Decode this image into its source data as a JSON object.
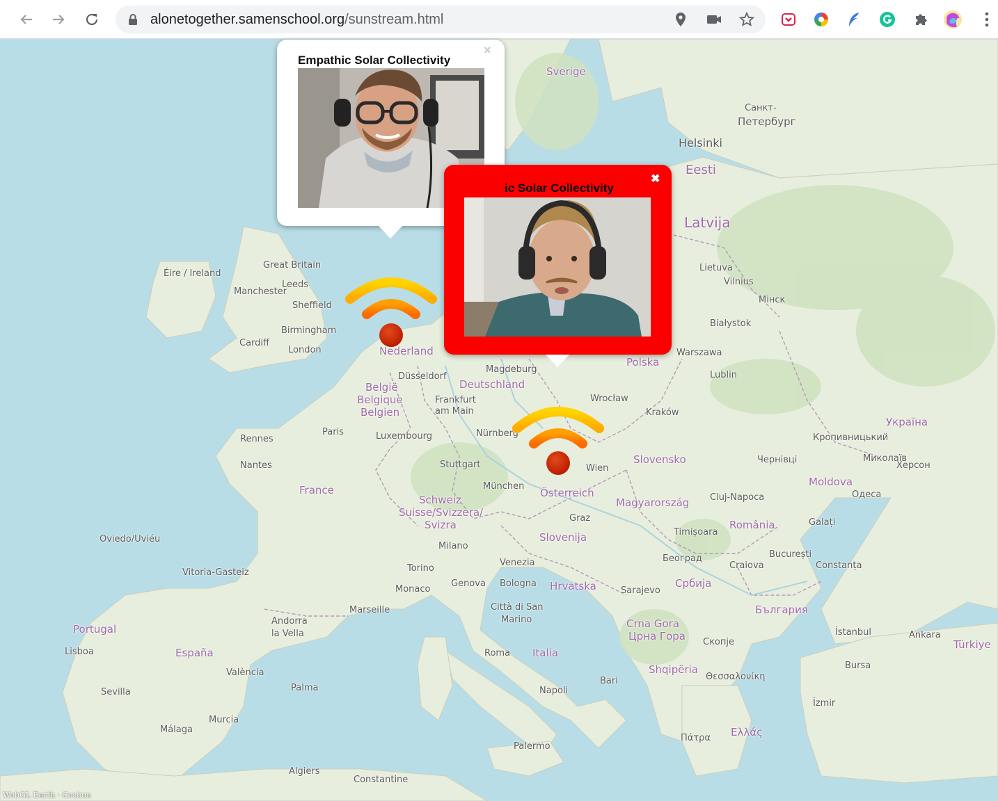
{
  "browser": {
    "url_host": "alonetogether.samenschool.org",
    "url_path": "/sunstream.html"
  },
  "map": {
    "countries": {
      "sverige": "Sverige",
      "eesti": "Eesti",
      "latvija": "Latvija",
      "lietuva": "Lietuva",
      "polska": "Polska",
      "nederland": "Nederland",
      "belgie": "België",
      "belgique": "Belgique",
      "belgien": "Belgien",
      "deutschland": "Deutschland",
      "luxembourg": "Luxembourg",
      "france": "France",
      "schweiz": "Schweiz",
      "suisse": "Suisse/Svizzera/",
      "svizra": "Svizra",
      "osterreich": "Österreich",
      "slovensko": "Slovensko",
      "magyarorszag": "Magyarország",
      "romania": "România",
      "slovenija": "Slovenija",
      "hrvatska": "Hrvatska",
      "srbija": "Србија",
      "italia": "Italia",
      "espana": "España",
      "portugal": "Portugal",
      "shqiperia": "Shqipëria",
      "crna_gora": "Crna Gora",
      "crna_gora_cyr": "Црна Гора",
      "balgariya": "България",
      "ellada": "Ελλάς",
      "turkiye": "Türkiye",
      "ukraina": "Україна",
      "moldova": "Moldova",
      "great_britain": "Great Britain",
      "eire": "Éire / Ireland",
      "andorra": "Andorra",
      "andorra2": "la Vella",
      "citta": "Città di San",
      "marino": "Marino",
      "monaco": "Monaco"
    },
    "cities": {
      "helsinki": "Helsinki",
      "sankt": "Санкт-",
      "peterburg": "Петербург",
      "leeds": "Leeds",
      "sheffield": "Sheffield",
      "birmingham": "Birmingham",
      "london": "London",
      "cardiff": "Cardiff",
      "manchester": "Manchester",
      "dusseldorf": "Düsseldorf",
      "frankfurt": "Frankfurt",
      "frankfurt2": "am Main",
      "nurnberg": "Nürnberg",
      "stuttgart": "Stuttgart",
      "munchen": "München",
      "wien": "Wien",
      "graz": "Graz",
      "paris": "Paris",
      "rennes": "Rennes",
      "nantes": "Nantes",
      "magdeburg": "Magdeburg",
      "wroclaw": "Wrocław",
      "krakow": "Kraków",
      "warszawa": "Warszawa",
      "lublin": "Lublin",
      "bialystok": "Białystok",
      "vilnius": "Vilnius",
      "minsk": "Мінск",
      "cluj": "Cluj-Napoca",
      "timisoara": "Timișoara",
      "beograd": "Београд",
      "bucuresti": "București",
      "craiova": "Craiova",
      "constanta": "Constanța",
      "galati": "Galați",
      "odesa": "Одеса",
      "sarajevo": "Sarajevo",
      "skopje": "Скопје",
      "milano": "Milano",
      "torino": "Torino",
      "genova": "Genova",
      "bologna": "Bologna",
      "venezia": "Venezia",
      "roma": "Roma",
      "napoli": "Napoli",
      "bari": "Bari",
      "palermo": "Palermo",
      "marseille": "Marseille",
      "valencia": "València",
      "palma": "Palma",
      "murcia": "Murcia",
      "sevilla": "Sevilla",
      "malaga": "Málaga",
      "lisboa": "Lisboa",
      "oviedo": "Oviedo/Uviéu",
      "vitoria": "Vitoria-Gasteiz",
      "algiers": "Algiers",
      "constantine": "Constantine",
      "istanbul": "İstanbul",
      "ankara": "Ankara",
      "bursa": "Bursa",
      "izmir": "İzmir",
      "thessaloniki": "Θεσσαλονίκη",
      "patra": "Πάτρα",
      "kyiv": "Кропивницький",
      "kherson": "Херсон",
      "mykolaiv": "Миколаїв",
      "chernivtsi": "Чернівці"
    },
    "attribution": "WebGL Earth · Cesium"
  },
  "popups": [
    {
      "title": "Empathic Solar Collectivity",
      "close": "×"
    },
    {
      "title": "ic Solar Collectivity",
      "close": "✖"
    }
  ]
}
